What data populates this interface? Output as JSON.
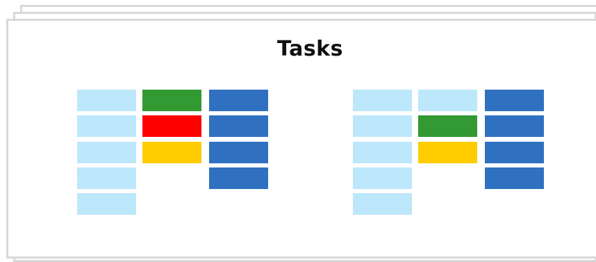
{
  "title": "Tasks",
  "colors": {
    "light_blue": "#bde7fb",
    "green": "#339933",
    "red": "#ff0000",
    "yellow": "#ffcc00",
    "blue": "#3070c0"
  },
  "boards": [
    {
      "columns": [
        [
          "light_blue",
          "light_blue",
          "light_blue",
          "light_blue",
          "light_blue"
        ],
        [
          "green",
          "red",
          "yellow"
        ],
        [
          "blue",
          "blue",
          "blue",
          "blue"
        ]
      ]
    },
    {
      "columns": [
        [
          "light_blue",
          "light_blue",
          "light_blue",
          "light_blue",
          "light_blue"
        ],
        [
          "light_blue",
          "green",
          "yellow"
        ],
        [
          "blue",
          "blue",
          "blue",
          "blue"
        ]
      ]
    }
  ]
}
